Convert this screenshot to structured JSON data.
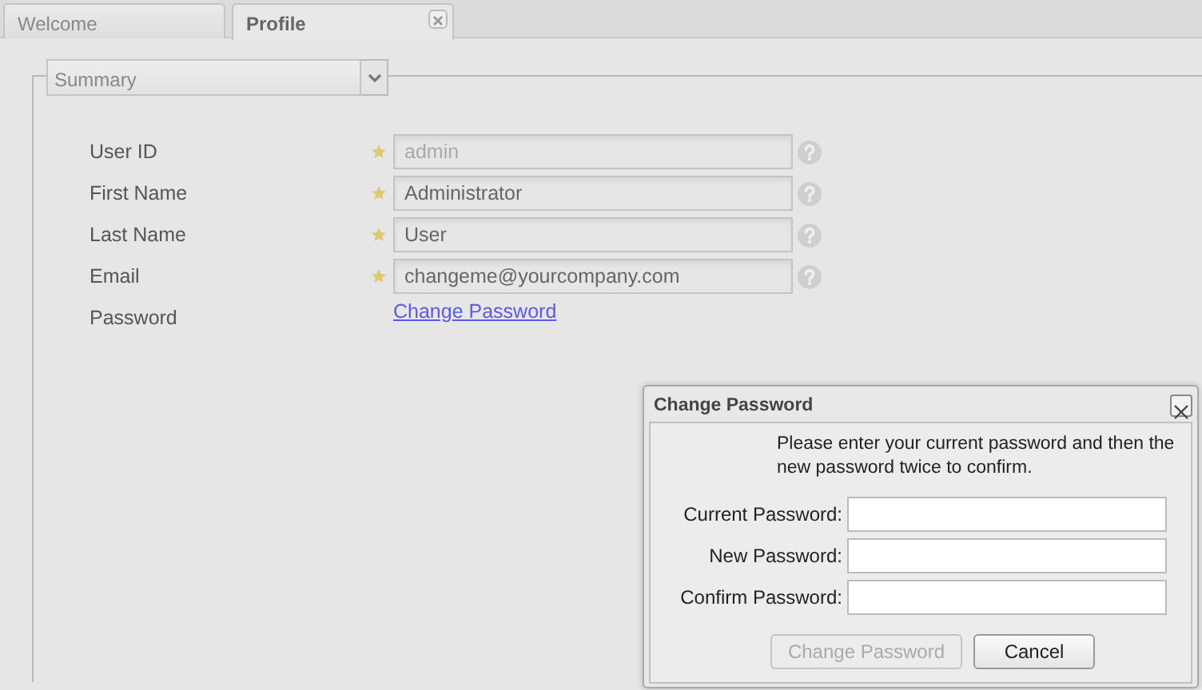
{
  "tabs": [
    {
      "label": "Welcome",
      "selected": false,
      "closable": false
    },
    {
      "label": "Profile",
      "selected": true,
      "closable": true
    }
  ],
  "section": {
    "title": "Summary"
  },
  "fields": [
    {
      "kind": "input",
      "label": "User ID",
      "required": true,
      "value": "admin",
      "disabled": true
    },
    {
      "kind": "input",
      "label": "First Name",
      "required": true,
      "value": "Administrator",
      "disabled": false
    },
    {
      "kind": "input",
      "label": "Last Name",
      "required": true,
      "value": "User",
      "disabled": false
    },
    {
      "kind": "input",
      "label": "Email",
      "required": true,
      "value": "changeme@yourcompany.com",
      "disabled": false
    },
    {
      "kind": "link",
      "label": "Password",
      "value": "Change Password"
    }
  ],
  "dialog": {
    "title": "Change Password",
    "message": "Please enter your current password and then the new password twice to confirm.",
    "fields": [
      {
        "label": "Current Password:"
      },
      {
        "label": "New Password:"
      },
      {
        "label": "Confirm Password:"
      }
    ],
    "buttons": [
      {
        "label": "Change Password",
        "disabled": true
      },
      {
        "label": "Cancel",
        "disabled": false
      }
    ]
  }
}
